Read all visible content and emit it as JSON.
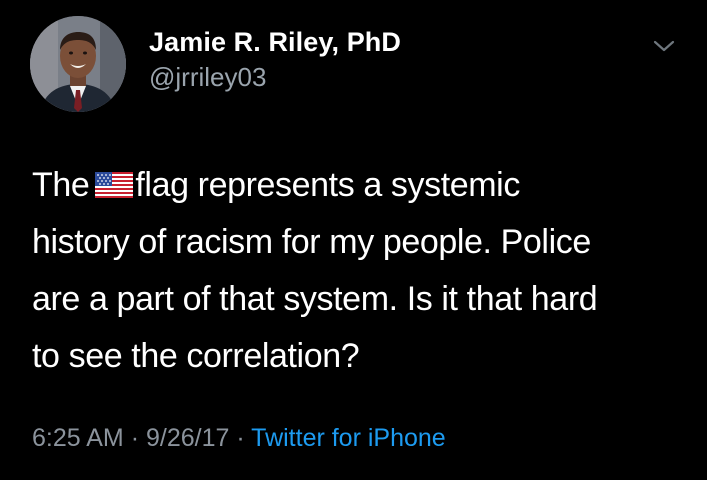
{
  "author": {
    "display_name": "Jamie R. Riley, PhD",
    "handle": "@jrriley03"
  },
  "tweet": {
    "text_before_flag": "The",
    "flag_emoji": "us-flag-icon",
    "lines": [
      "flag represents a systemic",
      "history of racism for my people. Police",
      "are a part of that system. Is it that hard",
      "to see the correlation?"
    ]
  },
  "meta": {
    "time": "6:25 AM",
    "separator": "·",
    "date": "9/26/17",
    "source": "Twitter for iPhone"
  },
  "icons": {
    "menu": "chevron-down-icon",
    "avatar": "profile-photo"
  },
  "colors": {
    "background": "#000000",
    "text": "#ffffff",
    "secondary": "#8b939c",
    "link": "#1d9bf0"
  }
}
